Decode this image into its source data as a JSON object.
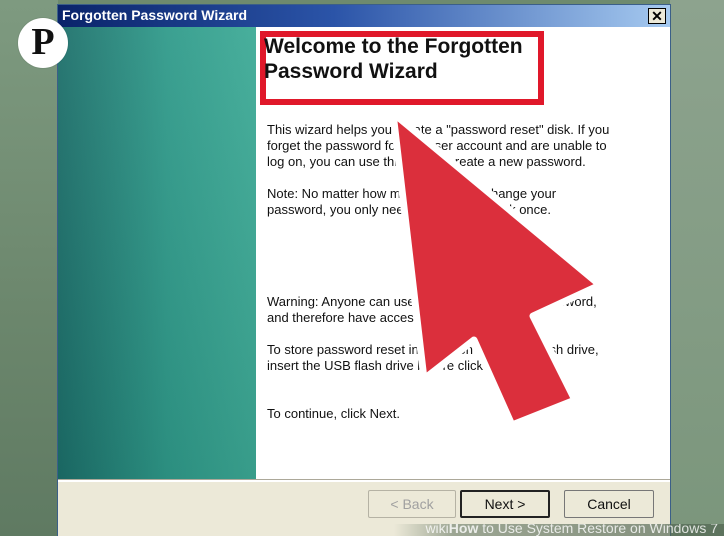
{
  "window": {
    "title": "Forgotten Password Wizard"
  },
  "content": {
    "heading": "Welcome to the Forgotten Password Wizard",
    "paragraphs": [
      "This wizard helps you create a \"password reset\" disk. If you forget the password for this user account and are unable to log on, you can use this disk to create a new password.",
      "Note: No matter how many times you change your password, you only need to create this disk once.",
      "Warning: Anyone can use this disk to reset the password, and therefore have access to this account.",
      "To store password reset information on a USB flash drive, insert the USB flash drive before clicking Next.",
      "To continue, click Next."
    ]
  },
  "buttons": {
    "back": "< Back",
    "next": "Next >",
    "cancel": "Cancel"
  },
  "watermark": {
    "site": "wiki",
    "bold": "How",
    "rest": " to Use System Restore on Windows 7"
  },
  "icons": {
    "pinterest": "pinterest-icon",
    "close": "close-icon",
    "arrow": "red-arrow-annotation"
  },
  "colors": {
    "highlight": "#e0182a",
    "title_bar": "#0a246a",
    "side_panel": "#2f9a8a"
  }
}
